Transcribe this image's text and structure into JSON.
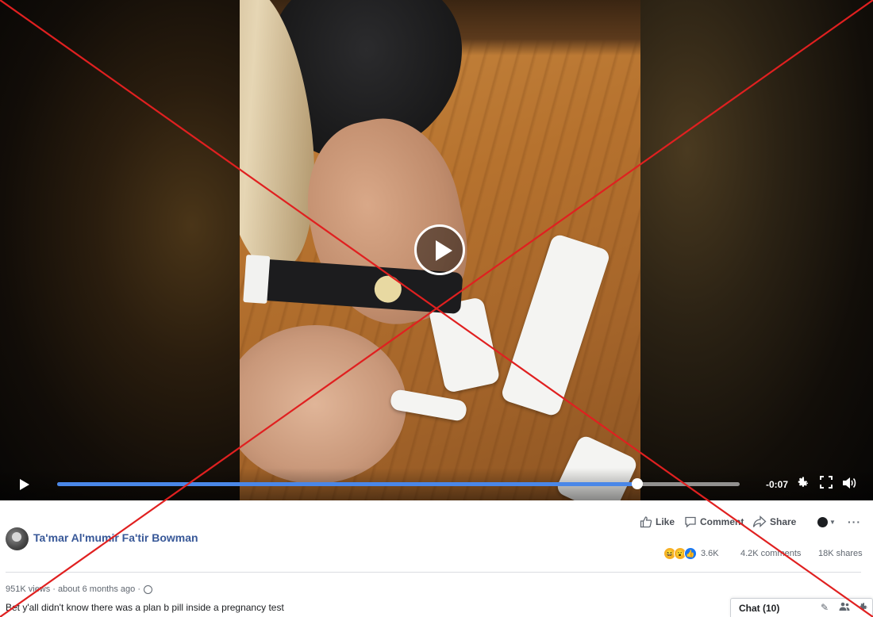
{
  "video": {
    "time_remaining": "-0:07",
    "progress": 0.85,
    "play_icon": "play-icon",
    "settings_icon": "gear-icon",
    "fullscreen_icon": "fullscreen-icon",
    "volume_icon": "volume-icon",
    "accent_color": "#4a87e8"
  },
  "post": {
    "author": "Ta'mar Al'mumir Fa'tir Bowman",
    "actions": {
      "like": "Like",
      "comment": "Comment",
      "share": "Share",
      "more": "···"
    },
    "reactions_count": "3.6K",
    "comments_count": "4.2K comments",
    "shares_count": "18K shares",
    "meta": "951K views · about 6 months ago ·",
    "caption": "Bet y'all didn't know there was a plan b pill inside a pregnancy test",
    "link_color": "#385898"
  },
  "chat": {
    "label": "Chat (10)"
  },
  "overlay": {
    "color": "#e02020"
  }
}
